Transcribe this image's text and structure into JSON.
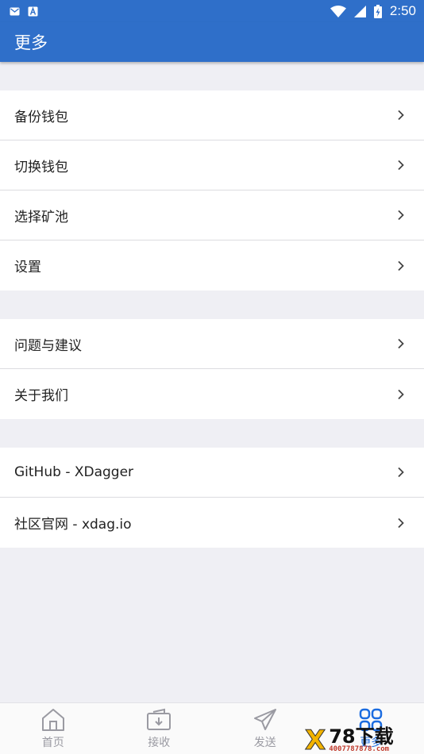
{
  "colors": {
    "primary": "#2f6fc9",
    "background": "#efeff4",
    "nav_active": "#1b6ce0",
    "nav_inactive": "#9a9aa2"
  },
  "status_bar": {
    "time": "2:50",
    "icons": [
      "mail-icon",
      "font-icon",
      "wifi-icon",
      "signal-icon",
      "battery-charging-icon"
    ]
  },
  "app_bar": {
    "title": "更多"
  },
  "menu": {
    "group1": [
      {
        "label": "备份钱包",
        "icon": "chevron-right-icon"
      },
      {
        "label": "切换钱包",
        "icon": "chevron-right-icon"
      },
      {
        "label": "选择矿池",
        "icon": "chevron-right-icon"
      },
      {
        "label": "设置",
        "icon": "chevron-right-icon"
      }
    ],
    "group2": [
      {
        "label": "问题与建议",
        "icon": "chevron-right-icon"
      },
      {
        "label": "关于我们",
        "icon": "chevron-right-icon"
      }
    ],
    "group3": [
      {
        "label": "GitHub - XDagger",
        "icon": "chevron-right-icon"
      },
      {
        "label": "社区官网 - xdag.io",
        "icon": "chevron-right-icon"
      }
    ]
  },
  "bottom_nav": [
    {
      "label": "首页",
      "icon": "home-icon"
    },
    {
      "label": "接收",
      "icon": "wallet-receive-icon"
    },
    {
      "label": "发送",
      "icon": "paper-plane-icon"
    },
    {
      "label": "更多",
      "icon": "more-grid-icon",
      "active": true
    }
  ],
  "watermark": {
    "logo": "X",
    "text": "78下载",
    "url": "4007787878.com"
  }
}
